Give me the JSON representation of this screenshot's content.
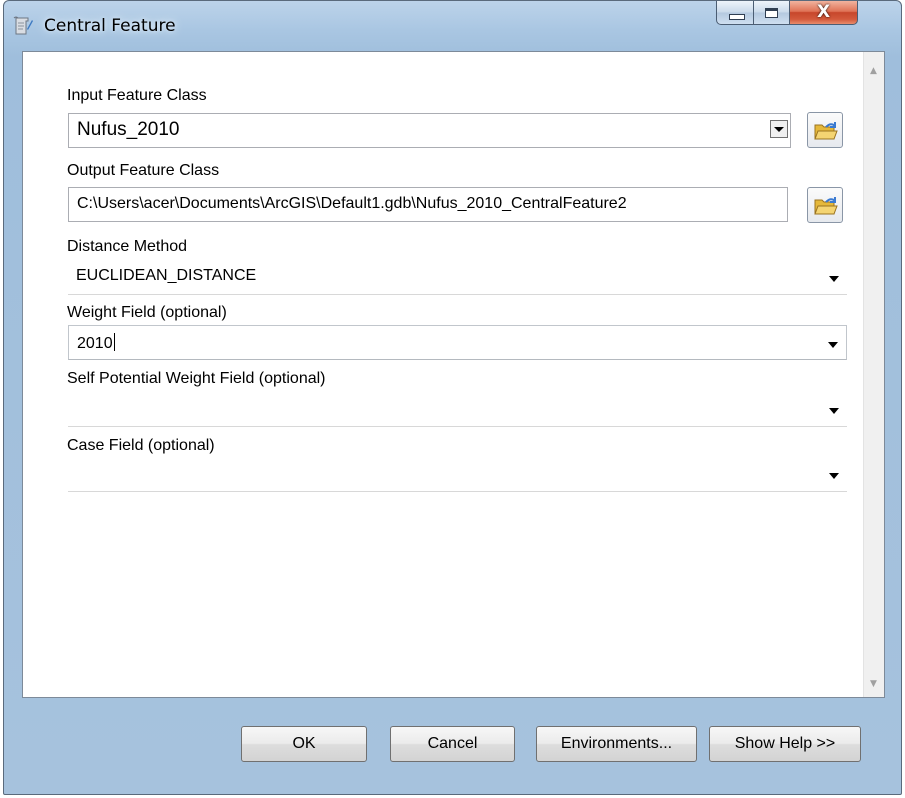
{
  "window": {
    "title": "Central Feature",
    "close_glyph": "X"
  },
  "form": {
    "input_feature_class": {
      "label": "Input Feature Class",
      "value": "Nufus_2010"
    },
    "output_feature_class": {
      "label": "Output Feature Class",
      "value": "C:\\Users\\acer\\Documents\\ArcGIS\\Default1.gdb\\Nufus_2010_CentralFeature2"
    },
    "distance_method": {
      "label": "Distance Method",
      "value": "EUCLIDEAN_DISTANCE"
    },
    "weight_field": {
      "label": "Weight Field (optional)",
      "value": "2010"
    },
    "self_potential_weight_field": {
      "label": "Self Potential Weight Field (optional)",
      "value": ""
    },
    "case_field": {
      "label": "Case Field (optional)",
      "value": ""
    }
  },
  "buttons": {
    "ok": "OK",
    "cancel": "Cancel",
    "environments": "Environments...",
    "show_help": "Show Help >>"
  },
  "icons": {
    "app": "toolbox-script-icon",
    "browse": "open-folder-icon",
    "scroll_up": "scroll-up-arrow-icon",
    "scroll_down": "scroll-down-arrow-icon"
  },
  "colors": {
    "titlebar": "#a9c6e2",
    "close_button": "#c7462b",
    "folder": "#e5b83a"
  }
}
